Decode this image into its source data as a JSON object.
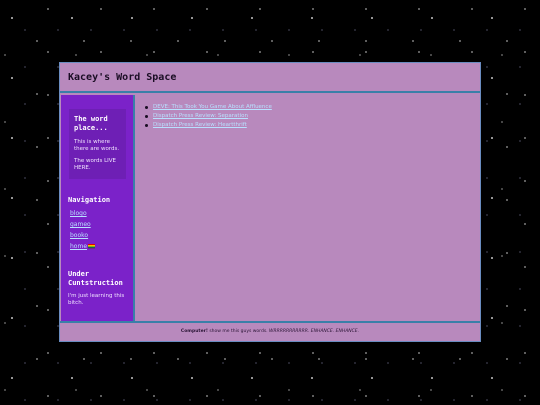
{
  "header": {
    "title": "Kacey's Word Space"
  },
  "sidebar": {
    "card": {
      "title": "The word place...",
      "line1": "This is where there are words.",
      "line2": "The words LIVE HERE."
    },
    "navigation": {
      "title": "Navigation",
      "items": [
        {
          "label": "blogo"
        },
        {
          "label": "gameo"
        },
        {
          "label": "booko"
        },
        {
          "label": "home",
          "icon": "rainbow-flag-icon"
        }
      ]
    },
    "under": {
      "title": "Under Cuntstruction",
      "text": "I'm just learning this bitch."
    }
  },
  "main": {
    "posts": [
      {
        "title": "DEVE: This Took You Game About Affluence"
      },
      {
        "title": "Dispatch Press Review: Separation"
      },
      {
        "title": "Dispatch Press Review: Heartthrift"
      }
    ]
  },
  "footer": {
    "bold": "Computer!",
    "text": " show me this guys words. ",
    "emph": "WRRRRRRRRRRR. ENHANCE. ENHANCE."
  },
  "colors": {
    "page_bg": "#b889bd",
    "sidebar_bg": "#7b22c9",
    "border": "#3a7fa8",
    "link": "#b8e0ff"
  }
}
